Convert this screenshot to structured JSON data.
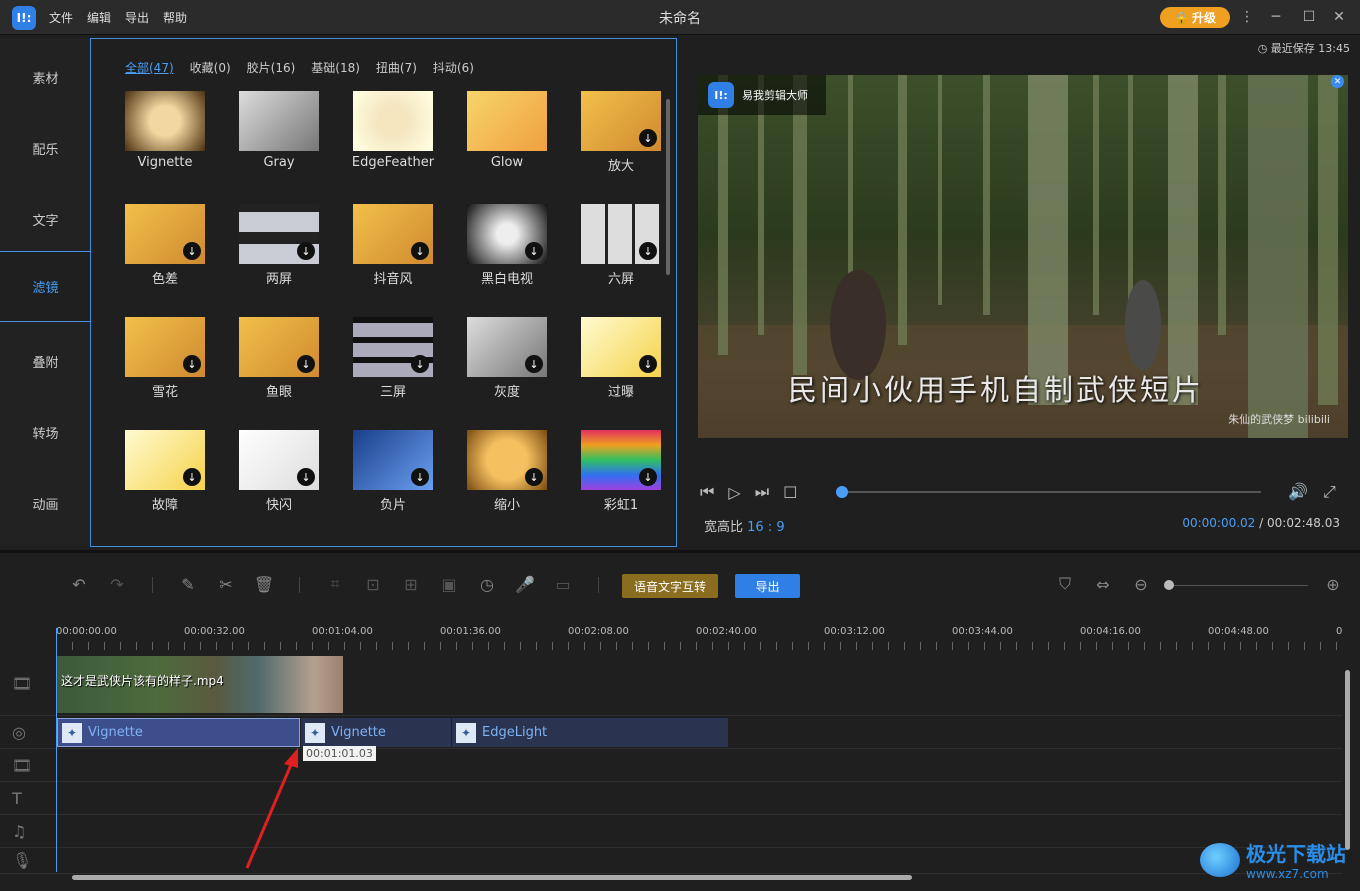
{
  "app": {
    "logo_glyph": "I!:",
    "title": "未命名",
    "upgrade_label": "升级"
  },
  "menu": [
    "文件",
    "编辑",
    "导出",
    "帮助"
  ],
  "sidebar": {
    "items": [
      "素材",
      "配乐",
      "文字",
      "滤镜",
      "叠附",
      "转场",
      "动画"
    ],
    "active_index": 3
  },
  "filters": {
    "tabs": [
      "全部(47)",
      "收藏(0)",
      "胶片(16)",
      "基础(18)",
      "扭曲(7)",
      "抖动(6)"
    ],
    "active_tab": 0,
    "items": [
      {
        "label": "Vignette",
        "style": "vignette",
        "download": false
      },
      {
        "label": "Gray",
        "style": "gray",
        "download": false
      },
      {
        "label": "EdgeFeather",
        "style": "feather",
        "download": false
      },
      {
        "label": "Glow",
        "style": "glow",
        "download": false
      },
      {
        "label": "放大",
        "style": "normal",
        "download": true
      },
      {
        "label": "色差",
        "style": "normal",
        "download": true
      },
      {
        "label": "两屏",
        "style": "split2",
        "download": true
      },
      {
        "label": "抖音风",
        "style": "normal",
        "download": true
      },
      {
        "label": "黑白电视",
        "style": "bwtv",
        "download": true
      },
      {
        "label": "六屏",
        "style": "split6",
        "download": true
      },
      {
        "label": "雪花",
        "style": "normal",
        "download": true
      },
      {
        "label": "鱼眼",
        "style": "normal",
        "download": true
      },
      {
        "label": "三屏",
        "style": "split3",
        "download": true
      },
      {
        "label": "灰度",
        "style": "gray",
        "download": true
      },
      {
        "label": "过曝",
        "style": "over",
        "download": true
      },
      {
        "label": "故障",
        "style": "over",
        "download": true
      },
      {
        "label": "快闪",
        "style": "flash",
        "download": true
      },
      {
        "label": "负片",
        "style": "negative",
        "download": true
      },
      {
        "label": "缩小",
        "style": "shrink",
        "download": true
      },
      {
        "label": "彩虹1",
        "style": "rainbow",
        "download": true
      }
    ]
  },
  "preview": {
    "saved": "最近保存 13:45",
    "badge": "易我剪辑大师",
    "subtitle": "民间小伙用手机自制武侠短片",
    "watermark": "朱仙的武侠梦 bilibili",
    "progress": 0.0,
    "aspect_label": "宽高比",
    "aspect_value": "16 : 9",
    "current_time": "00:00:00.02",
    "separator": "/",
    "total_time": "00:02:48.03"
  },
  "toolbar": {
    "speech_label": "语音文字互转",
    "export_label": "导出"
  },
  "ruler": [
    "00:00:00.00",
    "00:00:32.00",
    "00:01:04.00",
    "00:01:36.00",
    "00:02:08.00",
    "00:02:40.00",
    "00:03:12.00",
    "00:03:44.00",
    "00:04:16.00",
    "00:04:48.00",
    "0"
  ],
  "timeline": {
    "video_clip": "这才是武侠片该有的样子.mp4",
    "filter_clips": [
      "Vignette",
      "Vignette",
      "EdgeLight"
    ],
    "tooltip": "00:01:01.03"
  },
  "site_watermark": {
    "name": "极光下载站",
    "url": "www.xz7.com"
  },
  "colors": {
    "accent": "#2f7fe6",
    "upgrade": "#f0a020",
    "speech": "#8a6d1e",
    "annotation_arrow": "#e02020"
  }
}
